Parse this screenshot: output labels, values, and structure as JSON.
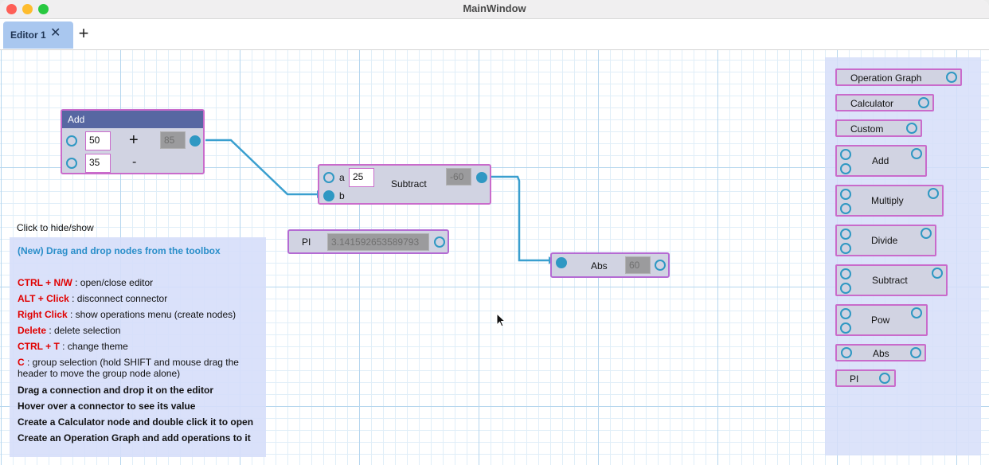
{
  "window": {
    "title": "MainWindow"
  },
  "tabs": [
    {
      "label": "Editor 1",
      "close": "✕"
    }
  ],
  "tab_add": "+",
  "nodes": {
    "add": {
      "title": "Add",
      "a": "50",
      "b": "35",
      "plus": "+",
      "minus": "-",
      "result": "85"
    },
    "subtract": {
      "title": "Subtract",
      "a_label": "a",
      "a_value": "25",
      "b_label": "b",
      "result": "-60"
    },
    "pi": {
      "title": "PI",
      "value": "3.141592653589793"
    },
    "abs": {
      "title": "Abs",
      "result": "60"
    }
  },
  "help": {
    "toggle": "Click to hide/show",
    "title": "(New) Drag and drop nodes from the toolbox",
    "shortcuts": [
      {
        "key": "CTRL + N/W",
        "desc": " : open/close editor"
      },
      {
        "key": "ALT + Click",
        "desc": " : disconnect connector"
      },
      {
        "key": "Right Click",
        "desc": " : show operations menu (create nodes)"
      },
      {
        "key": "Delete",
        "desc": " : delete selection"
      },
      {
        "key": "CTRL + T",
        "desc": " : change theme"
      },
      {
        "key": "C",
        "desc": " : group selection (hold SHIFT and mouse drag the"
      }
    ],
    "continuation": "header to move the group node alone)",
    "tips": [
      "Drag a connection and drop it on the editor",
      "Hover over a connector to see its value",
      "Create a Calculator node and double click it to open",
      "Create an Operation Graph and add operations to it"
    ]
  },
  "toolbox": {
    "items": [
      "Operation Graph",
      "Calculator",
      "Custom",
      "Add",
      "Multiply",
      "Divide",
      "Subtract",
      "Pow",
      "Abs",
      "PI"
    ]
  },
  "colors": {
    "accent": "#2f98c3",
    "node_border": "#c96bcb",
    "node_header": "#5767a2",
    "node_body": "#d1d3e2",
    "shortcut_key": "#e00000",
    "help_title": "#2a8ec9",
    "tab_active": "#a9c7ef"
  },
  "icons": [
    "close-icon",
    "plus-icon",
    "cursor-icon",
    "connector-icon"
  ]
}
